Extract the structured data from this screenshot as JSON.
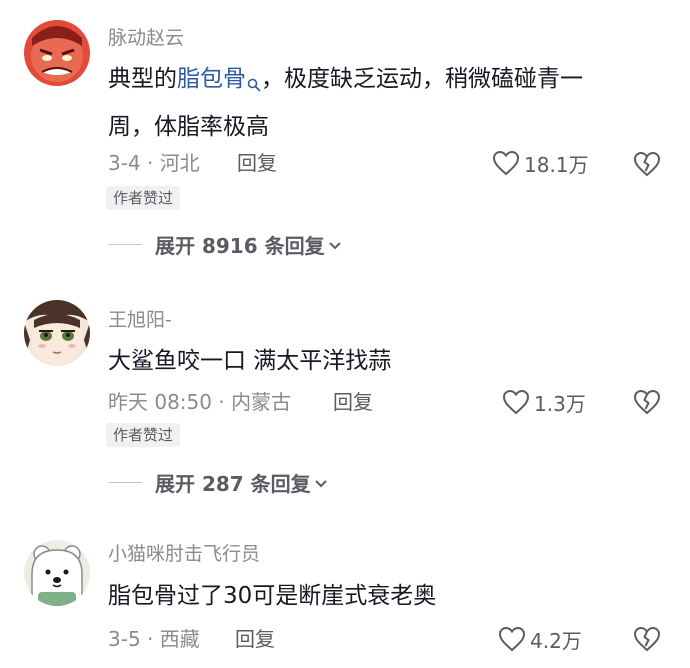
{
  "comments": [
    {
      "username": "脉动赵云",
      "avatar_icon": "red-angry-face-avatar",
      "text_before": "典型的",
      "link_text": "脂包骨",
      "link_icon": "search-icon",
      "text_after_line1": "，极度缺乏运动，稍微磕碰青一",
      "text_line2": "周，体脂率极高",
      "meta": "3-4 · 河北",
      "reply_label": "回复",
      "like_count": "18.1万",
      "badge": "作者赞过",
      "expand_label": "展开 8916 条回复"
    },
    {
      "username": "王旭阳-",
      "avatar_icon": "anime-girl-avatar",
      "text": "大鲨鱼咬一口 满太平洋找蒜",
      "meta": "昨天 08:50 · 内蒙古",
      "reply_label": "回复",
      "like_count": "1.3万",
      "badge": "作者赞过",
      "expand_label": "展开 287 条回复"
    },
    {
      "username": "小猫咪肘击飞行员",
      "avatar_icon": "white-bear-avatar",
      "text": "脂包骨过了30可是断崖式衰老奥",
      "meta": "3-5 · 西藏",
      "reply_label": "回复",
      "like_count": "4.2万"
    }
  ],
  "colors": {
    "text": "#161823",
    "secondary": "#8a8b91",
    "link": "#2d5aa0",
    "badge_bg": "#f1f1f2"
  }
}
